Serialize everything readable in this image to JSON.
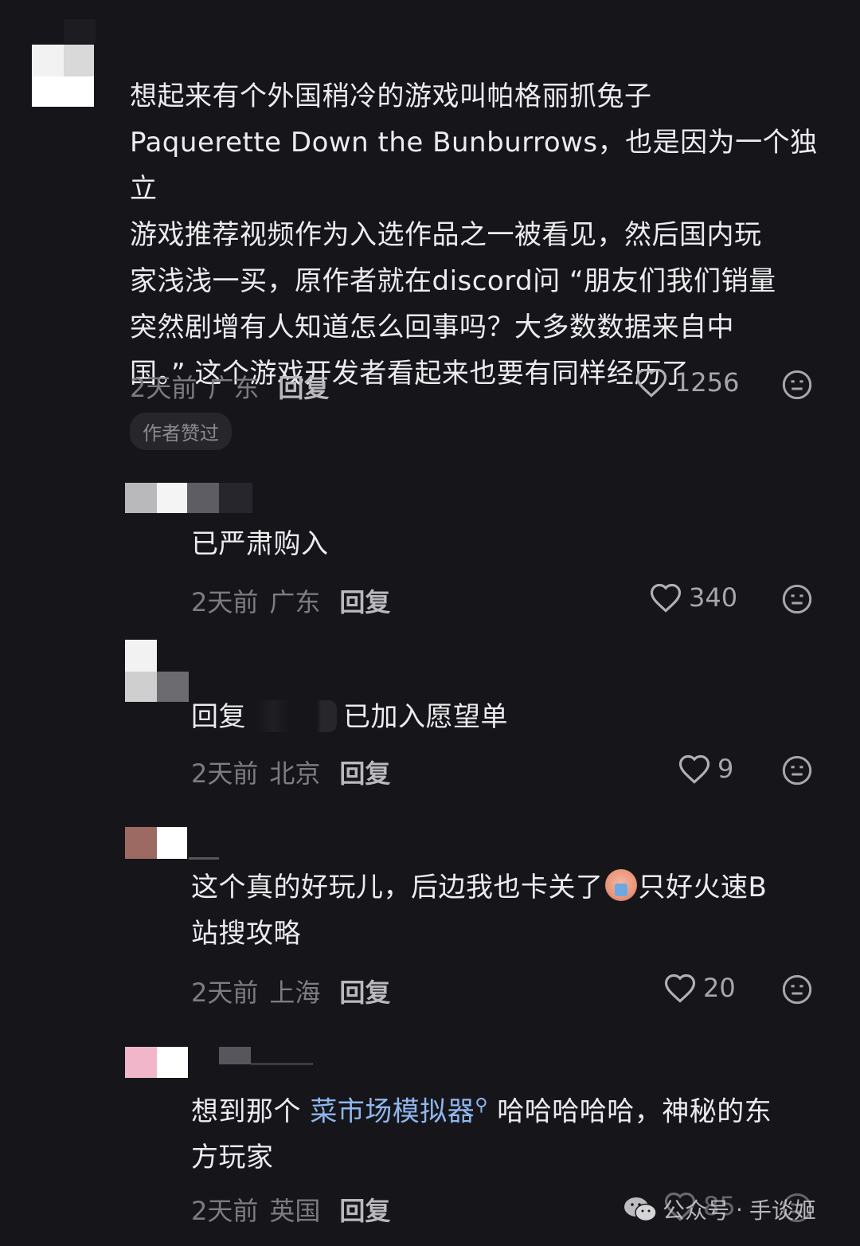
{
  "comments": [
    {
      "lines": [
        "想起来有个外国稍冷的游戏叫帕格丽抓兔子",
        "Paquerette Down the Bunburrows，也是因为一个独立",
        "游戏推荐视频作为入选作品之一被看见，然后国内玩",
        "家浅浅一买，原作者就在discord问 “朋友们我们销量",
        "突然剧增有人知道怎么回事吗？大多数数据来自中",
        "国。” 这个游戏开发者看起来也要有同样经历了"
      ],
      "time": "2天前",
      "location": "广东",
      "reply_label": "回复",
      "likes": "1256",
      "badge": "作者赞过"
    },
    {
      "text": "已严肃购入",
      "time": "2天前",
      "location": "广东",
      "reply_label": "回复",
      "likes": "340"
    },
    {
      "reply_prefix": "回复",
      "text": "已加入愿望单",
      "time": "2天前",
      "location": "北京",
      "reply_label": "回复",
      "likes": "9"
    },
    {
      "text_a": "这个真的好玩儿，后边我也卡关了",
      "text_b": "只好火速B",
      "text_c": "站搜攻略",
      "time": "2天前",
      "location": "上海",
      "reply_label": "回复",
      "likes": "20"
    },
    {
      "text_a": "想到那个 ",
      "link": "菜市场模拟器",
      "text_b": " 哈哈哈哈哈，神秘的东",
      "text_c": "方玩家",
      "time": "2天前",
      "location": "英国",
      "reply_label": "回复",
      "likes": "85"
    }
  ],
  "watermark": {
    "account_type": "公众号",
    "separator": "·",
    "name": "手谈姬"
  },
  "colors": {
    "background": "#16161a",
    "link": "#8fb6ee",
    "muted": "#7c7c82"
  }
}
